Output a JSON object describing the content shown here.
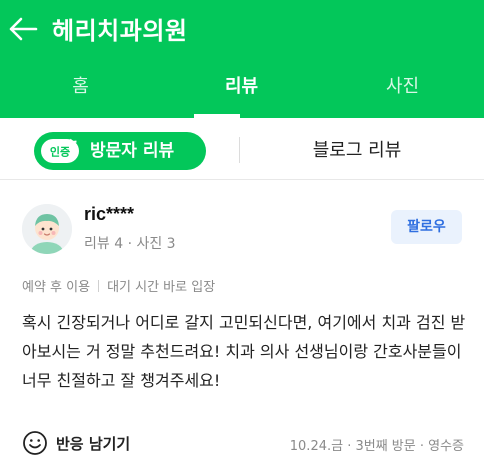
{
  "header": {
    "title": "헤리치과의원",
    "tabs": [
      {
        "label": "홈",
        "active": false
      },
      {
        "label": "리뷰",
        "active": true
      },
      {
        "label": "사진",
        "active": false
      }
    ]
  },
  "subtabs": {
    "visitor_badge": "인증",
    "visitor_label": "방문자 리뷰",
    "blog_label": "블로그 리뷰"
  },
  "review": {
    "username": "ric****",
    "stats": "리뷰 4 · 사진 3",
    "follow_label": "팔로우",
    "tags": [
      "예약 후 이용",
      "대기 시간 바로 입장"
    ],
    "text": "혹시 긴장되거나 어디로 갈지 고민되신다면, 여기에서 치과 검진 받아보시는 거 정말 추천드려요! 치과 의사 선생님이랑 간호사분들이 너무 친절하고 잘 챙겨주세요!",
    "react_label": "반응 남기기",
    "meta": "10.24.금 · 3번째 방문 · 영수증"
  },
  "colors": {
    "brand_green": "#03c75a",
    "follow_blue": "#2f6fe0"
  }
}
